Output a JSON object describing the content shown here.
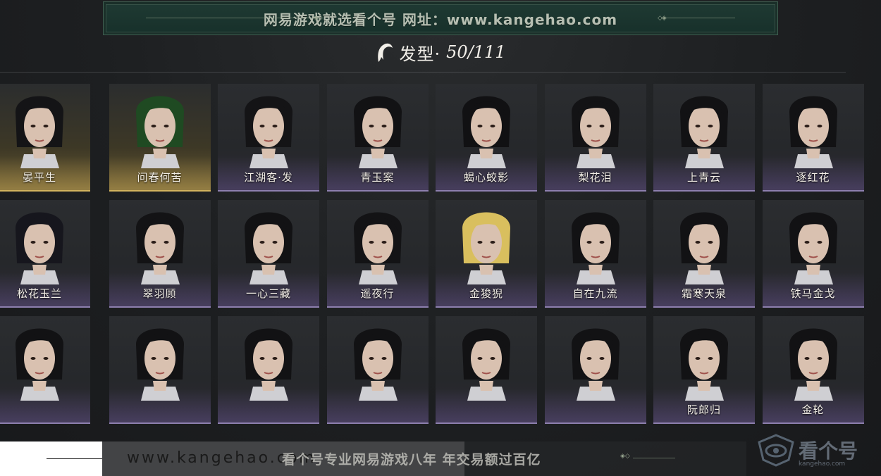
{
  "banner": {
    "text": "网易游戏就选看个号   网址：www.kangehao.com"
  },
  "section": {
    "icon": "hair-icon",
    "label": "发型·",
    "count": "50/111"
  },
  "hairstyles": [
    {
      "name": "晏平生",
      "owned": true,
      "hair": "#141416"
    },
    {
      "name": "问春何苦",
      "owned": true,
      "hair": "#1f4a22"
    },
    {
      "name": "江湖客·发",
      "owned": false,
      "hair": "#141416"
    },
    {
      "name": "青玉案",
      "owned": false,
      "hair": "#121214"
    },
    {
      "name": "蝎心蛟影",
      "owned": false,
      "hair": "#111113"
    },
    {
      "name": "梨花泪",
      "owned": false,
      "hair": "#131315"
    },
    {
      "name": "上青云",
      "owned": false,
      "hair": "#121214"
    },
    {
      "name": "逐红花",
      "owned": false,
      "hair": "#121214"
    },
    {
      "name": "松花玉兰",
      "owned": false,
      "hair": "#16161d"
    },
    {
      "name": "翠羽顾",
      "owned": false,
      "hair": "#131315"
    },
    {
      "name": "一心三藏",
      "owned": false,
      "hair": "#121214"
    },
    {
      "name": "遥夜行",
      "owned": false,
      "hair": "#131315"
    },
    {
      "name": "金狻猊",
      "owned": false,
      "hair": "#d9bf5e"
    },
    {
      "name": "自在九流",
      "owned": false,
      "hair": "#121214"
    },
    {
      "name": "霜寒天泉",
      "owned": false,
      "hair": "#121214"
    },
    {
      "name": "铁马金戈",
      "owned": false,
      "hair": "#121214"
    },
    {
      "name": "",
      "owned": false,
      "hair": "#121214"
    },
    {
      "name": "",
      "owned": false,
      "hair": "#121214"
    },
    {
      "name": "",
      "owned": false,
      "hair": "#121214"
    },
    {
      "name": "",
      "owned": false,
      "hair": "#121214"
    },
    {
      "name": "",
      "owned": false,
      "hair": "#121214"
    },
    {
      "name": "",
      "owned": false,
      "hair": "#121214"
    },
    {
      "name": "阮郎归",
      "owned": false,
      "hair": "#121214"
    },
    {
      "name": "金轮",
      "owned": false,
      "hair": "#121214"
    }
  ],
  "watermark": {
    "url": "www.kangehao.com",
    "slogan": "看个号专业网易游戏八年   年交易额过百亿",
    "logo_text": "看个号",
    "logo_sub": "kangehao.com"
  }
}
